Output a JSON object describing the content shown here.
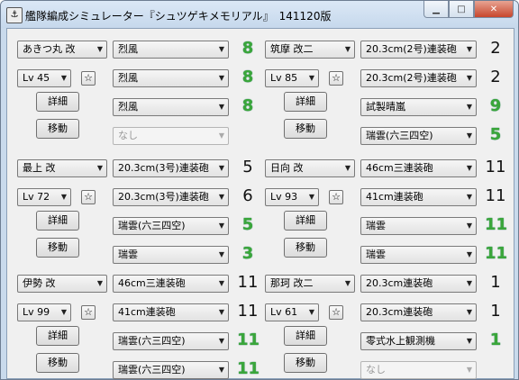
{
  "window": {
    "title": "艦隊編成シミュレーター『シュツゲキメモリアル』　141120版",
    "icon": "app-icon",
    "controls": [
      "minimize",
      "maximize",
      "close"
    ]
  },
  "buttons": {
    "detail": "詳細",
    "move": "移動",
    "favorite": "☆"
  },
  "colors": {
    "green_value": "#3aa63a",
    "normal_value": "#111111"
  },
  "ships": [
    {
      "name": "あきつ丸 改",
      "level": "Lv 45",
      "equipment": [
        {
          "name": "烈風",
          "value": "8",
          "green": true,
          "disabled": false
        },
        {
          "name": "烈風",
          "value": "8",
          "green": true,
          "disabled": false
        },
        {
          "name": "烈風",
          "value": "8",
          "green": true,
          "disabled": false
        },
        {
          "name": "なし",
          "value": "",
          "green": false,
          "disabled": true
        }
      ]
    },
    {
      "name": "筑摩 改二",
      "level": "Lv 85",
      "equipment": [
        {
          "name": "20.3cm(2号)連装砲",
          "value": "2",
          "green": false,
          "disabled": false
        },
        {
          "name": "20.3cm(2号)連装砲",
          "value": "2",
          "green": false,
          "disabled": false
        },
        {
          "name": "試製晴嵐",
          "value": "9",
          "green": true,
          "disabled": false
        },
        {
          "name": "瑞雲(六三四空)",
          "value": "5",
          "green": true,
          "disabled": false
        }
      ]
    },
    {
      "name": "最上 改",
      "level": "Lv 72",
      "equipment": [
        {
          "name": "20.3cm(3号)連装砲",
          "value": "5",
          "green": false,
          "disabled": false
        },
        {
          "name": "20.3cm(3号)連装砲",
          "value": "6",
          "green": false,
          "disabled": false
        },
        {
          "name": "瑞雲(六三四空)",
          "value": "5",
          "green": true,
          "disabled": false
        },
        {
          "name": "瑞雲",
          "value": "3",
          "green": true,
          "disabled": false
        }
      ]
    },
    {
      "name": "日向 改",
      "level": "Lv 93",
      "equipment": [
        {
          "name": "46cm三連装砲",
          "value": "11",
          "green": false,
          "disabled": false
        },
        {
          "name": "41cm連装砲",
          "value": "11",
          "green": false,
          "disabled": false
        },
        {
          "name": "瑞雲",
          "value": "11",
          "green": true,
          "disabled": false
        },
        {
          "name": "瑞雲",
          "value": "11",
          "green": true,
          "disabled": false
        }
      ]
    },
    {
      "name": "伊勢 改",
      "level": "Lv 99",
      "equipment": [
        {
          "name": "46cm三連装砲",
          "value": "11",
          "green": false,
          "disabled": false
        },
        {
          "name": "41cm連装砲",
          "value": "11",
          "green": false,
          "disabled": false
        },
        {
          "name": "瑞雲(六三四空)",
          "value": "11",
          "green": true,
          "disabled": false
        },
        {
          "name": "瑞雲(六三四空)",
          "value": "11",
          "green": true,
          "disabled": false
        }
      ]
    },
    {
      "name": "那珂 改二",
      "level": "Lv 61",
      "equipment": [
        {
          "name": "20.3cm連装砲",
          "value": "1",
          "green": false,
          "disabled": false
        },
        {
          "name": "20.3cm連装砲",
          "value": "1",
          "green": false,
          "disabled": false
        },
        {
          "name": "零式水上観測機",
          "value": "1",
          "green": true,
          "disabled": false
        },
        {
          "name": "なし",
          "value": "",
          "green": false,
          "disabled": true
        }
      ]
    }
  ]
}
